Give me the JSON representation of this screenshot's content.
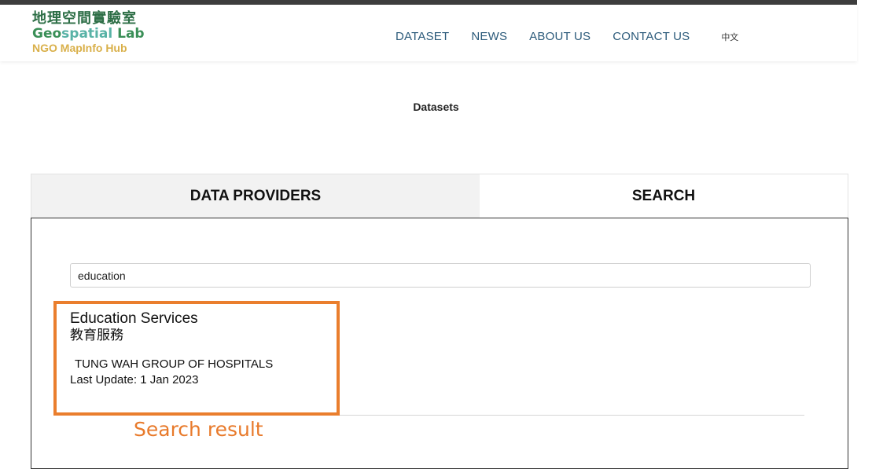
{
  "header": {
    "logo": {
      "title_zh": "地理空間實驗室",
      "title_en_geo": "Geo",
      "title_en_spatial": "spatial",
      "title_en_lab": " Lab",
      "subtitle": "NGO MapInfo Hub"
    },
    "nav": {
      "items": [
        {
          "label": "DATASET"
        },
        {
          "label": "NEWS"
        },
        {
          "label": "ABOUT US"
        },
        {
          "label": "CONTACT US"
        }
      ],
      "language_toggle": "中文"
    }
  },
  "page": {
    "title": "Datasets"
  },
  "tabs": [
    {
      "label": "DATA PROVIDERS",
      "active": false
    },
    {
      "label": "SEARCH",
      "active": true
    }
  ],
  "search": {
    "value": "education",
    "placeholder": ""
  },
  "results": [
    {
      "title": "Education Services",
      "title_zh": "教育服務",
      "provider": "TUNG WAH GROUP OF HOSPITALS",
      "last_update": "Last Update: 1 Jan 2023"
    }
  ],
  "annotation": {
    "label": "Search result",
    "color": "#ea7e2d"
  },
  "colors": {
    "nav_text": "#2b5a7a",
    "logo_green": "#2d6e46",
    "logo_teal": "#58b2a6",
    "logo_gold": "#d9b04a",
    "topbar": "#3d3d3d",
    "inactive_tab_bg": "#f2f2f2"
  }
}
